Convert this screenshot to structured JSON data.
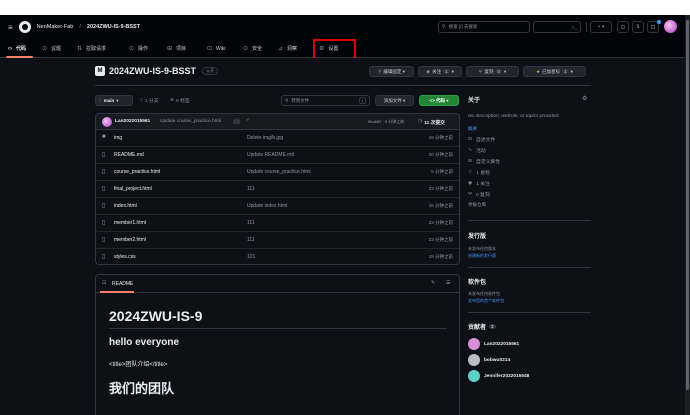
{
  "header": {
    "owner": "NeoMaker-Fab",
    "separator": "/",
    "repo": "2024ZWU-IS-9-BSST",
    "search_placeholder": "搜索 [/] 去搜索",
    "terminal_label": ">_",
    "plus_label": "+ ▾"
  },
  "nav": {
    "tabs": [
      {
        "label": "代码"
      },
      {
        "label": "议题"
      },
      {
        "label": "拉取请求"
      },
      {
        "label": "操作"
      },
      {
        "label": "项目"
      },
      {
        "label": "Wiki"
      },
      {
        "label": "安全"
      },
      {
        "label": "洞察"
      },
      {
        "label": "设置"
      }
    ]
  },
  "repo": {
    "name": "2024ZWU-IS-9-BSST",
    "visibility": "公开",
    "edit_pins": "编辑固定 ▾",
    "watch": "关注",
    "watch_count": "1",
    "fork": "复刻",
    "fork_count": "0",
    "star": "已加星标",
    "star_count": "1"
  },
  "toolbar": {
    "branch": "main",
    "branches": "1 分支",
    "tags": "0 标签",
    "go_to_file": "转到文件",
    "kbd": "t",
    "add_file": "添加文件 ▾",
    "code": "<> 代码 ▾"
  },
  "commit": {
    "author": "Lan2022015561",
    "message": "Update course_practice.html",
    "check": "✓",
    "hash": "86a682 · 5 分钟之前",
    "count": "11 次提交"
  },
  "files": [
    {
      "name": "img",
      "type": "folder",
      "message": "Delete img/b.jpg",
      "time": "16 分钟之前"
    },
    {
      "name": "README.md",
      "type": "file",
      "message": "Update README.md",
      "time": "20 分钟之前"
    },
    {
      "name": "course_practice.html",
      "type": "file",
      "message": "Update course_practice.html",
      "time": "5 分钟之前"
    },
    {
      "name": "final_project.html",
      "type": "file",
      "message": "111",
      "time": "23 分钟之前"
    },
    {
      "name": "index.html",
      "type": "file",
      "message": "Update index.html",
      "time": "16 分钟之前"
    },
    {
      "name": "member1.html",
      "type": "file",
      "message": "111",
      "time": "23 分钟之前"
    },
    {
      "name": "member2.html",
      "type": "file",
      "message": "111",
      "time": "23 分钟之前"
    },
    {
      "name": "styles.css",
      "type": "file",
      "message": "121",
      "time": "19 分钟之前"
    }
  ],
  "readme": {
    "tab": "README",
    "title": "2024ZWU-IS-9",
    "h2": "hello everyone",
    "line": "<title>团队介绍</title>",
    "h1b": "我们的团队"
  },
  "about": {
    "title": "关于",
    "description": "No description, website, or topics provided.",
    "readme": "自述文件",
    "activity": "活动",
    "custom_props": "自定义属性",
    "stars": "1 星标",
    "watching": "1 关注",
    "forks": "0 复刻",
    "report": "举报仓库",
    "tag_label": "概要"
  },
  "releases": {
    "title": "发行版",
    "none": "未发布任何版本",
    "create": "创建新的发行版"
  },
  "packages": {
    "title": "软件包",
    "none": "未发布任何软件包",
    "publish": "发布您的首个软件包"
  },
  "contributors": {
    "title": "贡献者",
    "count": "3",
    "list": [
      {
        "name": "Lan2022015561",
        "color": "#d78fd9"
      },
      {
        "name": "bobwu0214",
        "color": "#b8bec6"
      },
      {
        "name": "Jennifer2022015548",
        "color": "#5fd0c4"
      }
    ]
  },
  "colors": {
    "accent": "#2da44e",
    "highlight": "#e00000",
    "link": "#4493f8"
  }
}
